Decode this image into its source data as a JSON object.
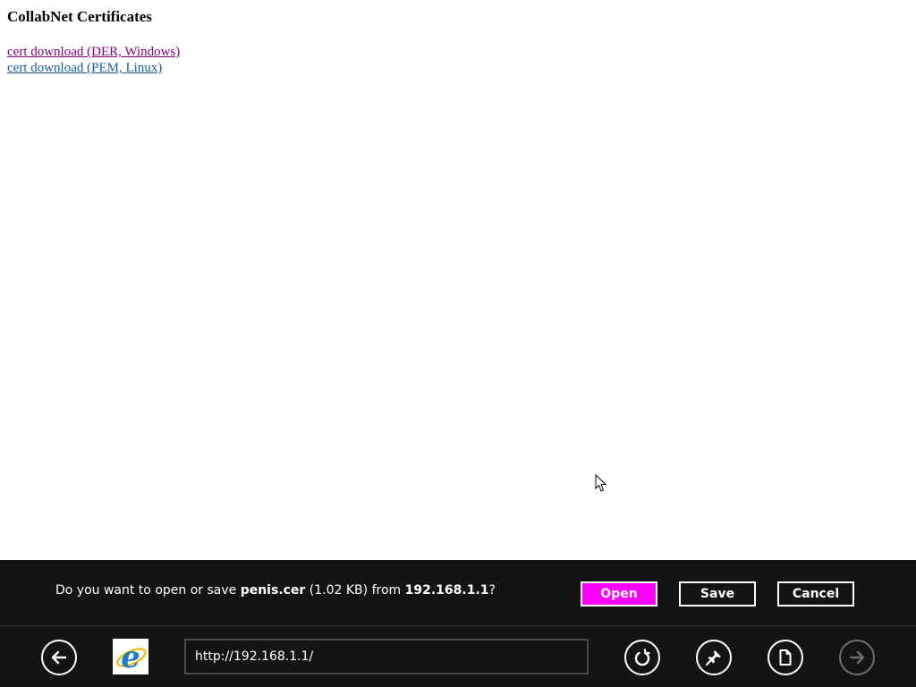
{
  "page": {
    "title": "CollabNet Certificates",
    "links": [
      {
        "label": "cert download (DER, Windows)",
        "visited": true
      },
      {
        "label": "cert download (PEM, Linux)",
        "visited": false
      }
    ]
  },
  "notification": {
    "prefix": "Do you want to open or save ",
    "file_name": "penis.cer",
    "file_size": " (1.02 KB) from ",
    "host": "192.168.1.1",
    "suffix": "?",
    "buttons": {
      "open": "Open",
      "save": "Save",
      "cancel": "Cancel"
    }
  },
  "address_bar": {
    "url": "http://192.168.1.1/",
    "icons": {
      "back": "back-arrow-icon",
      "browser": "ie-logo-icon",
      "refresh": "refresh-icon",
      "pin": "pin-icon",
      "page_tools": "page-tools-icon",
      "forward": "forward-arrow-icon"
    }
  },
  "colors": {
    "bar_background": "#141414",
    "primary_button": "#ff00ff",
    "visited_link": "#800080",
    "link": "#1a5e9a",
    "ie_blue": "#1a7fc4"
  }
}
